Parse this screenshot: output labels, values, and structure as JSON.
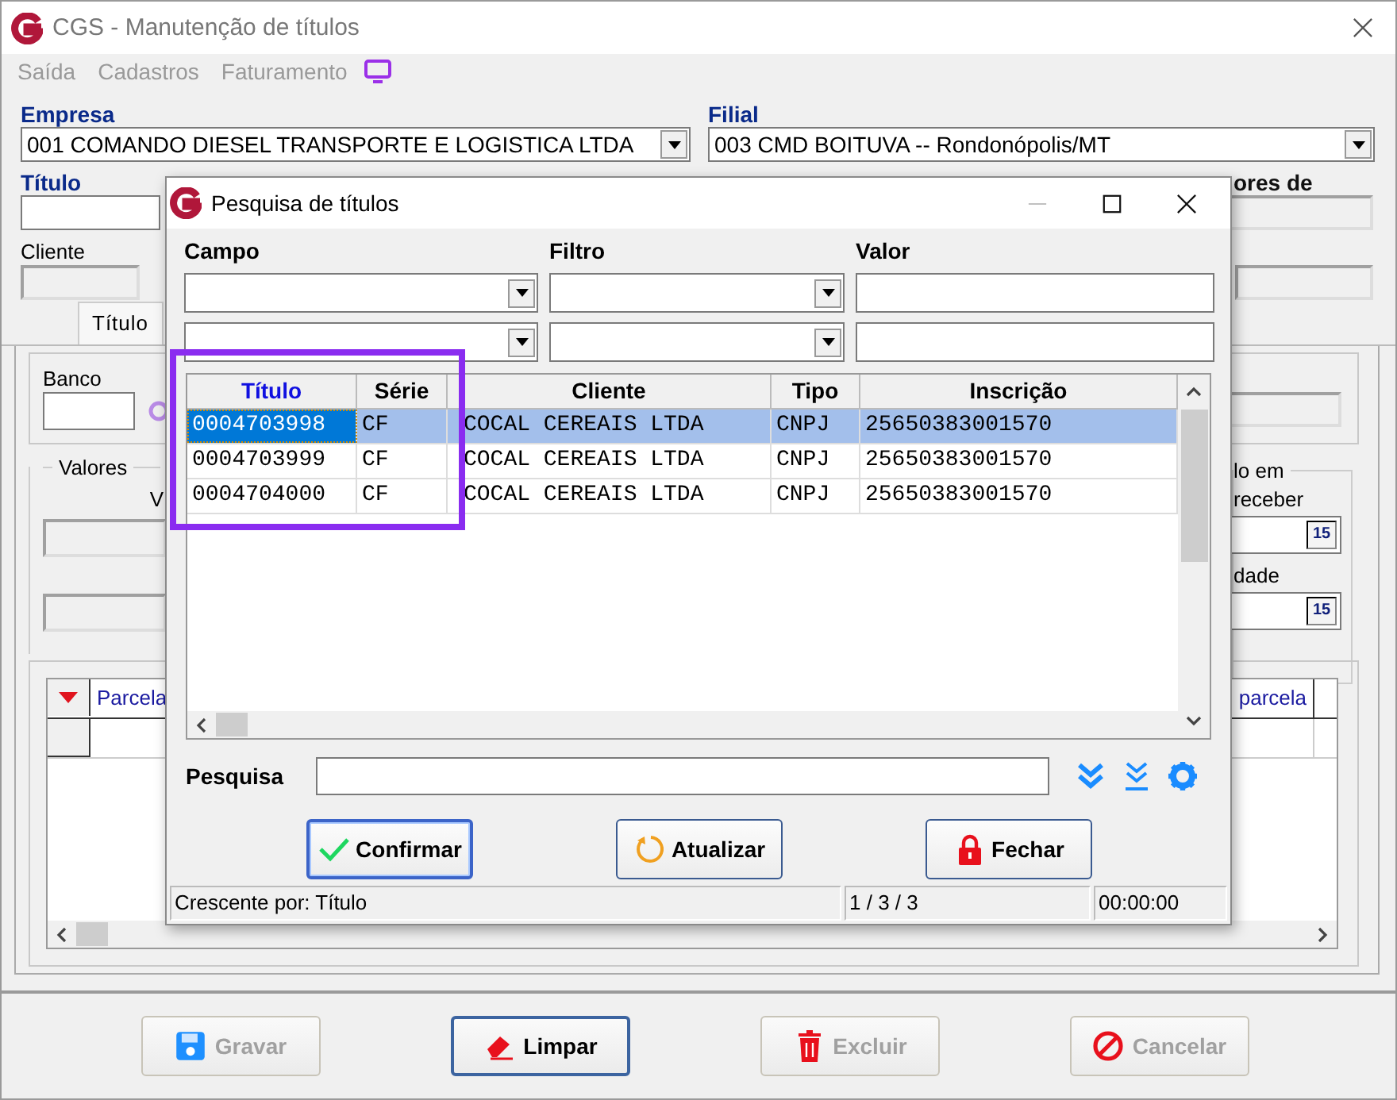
{
  "window": {
    "title": "CGS - Manutenção de títulos"
  },
  "menu": [
    {
      "label": "Saída",
      "disabled": true
    },
    {
      "label": "Cadastros",
      "disabled": true
    },
    {
      "label": "Faturamento",
      "disabled": true
    }
  ],
  "empresa": {
    "label": "Empresa",
    "value": "001 COMANDO DIESEL TRANSPORTE E LOGISTICA LTDA"
  },
  "filial": {
    "label": "Filial",
    "value": "003 CMD BOITUVA -- Rondonópolis/MT"
  },
  "titulo_label": "Título",
  "right_label": "ores de",
  "cliente_label": "Cliente",
  "tabs": [
    {
      "label": "Título",
      "selected": true
    }
  ],
  "banco_label": "Banco",
  "valores": {
    "legend": "Valores",
    "column_label": "V"
  },
  "dates": {
    "legend": "lo em",
    "label_1": "receber",
    "label_2": "dade",
    "calendar_labels": [
      "15",
      "15"
    ]
  },
  "grid": {
    "columns": [
      "Parcela",
      "parcela"
    ]
  },
  "buttons": [
    {
      "label": "Gravar",
      "kind": "save",
      "disabled": true,
      "focused": false
    },
    {
      "label": "Limpar",
      "kind": "eraser",
      "disabled": false,
      "focused": true
    },
    {
      "label": "Excluir",
      "kind": "trash",
      "disabled": true,
      "focused": false
    },
    {
      "label": "Cancelar",
      "kind": "cancel",
      "disabled": true,
      "focused": false
    }
  ],
  "dialog": {
    "title": "Pesquisa de títulos",
    "filter_headers": [
      "Campo",
      "Filtro",
      "Valor"
    ],
    "table": {
      "columns": [
        {
          "label": "Título",
          "sorted": true
        },
        {
          "label": "Série",
          "sorted": false
        },
        {
          "label": "Cliente",
          "sorted": false
        },
        {
          "label": "Tipo",
          "sorted": false
        },
        {
          "label": "Inscrição",
          "sorted": false
        }
      ],
      "rows": [
        {
          "cells": [
            "0004703998",
            "CF",
            "COCAL CEREAIS LTDA",
            "CNPJ",
            "25650383001570"
          ],
          "selected": true
        },
        {
          "cells": [
            "0004703999",
            "CF",
            "COCAL CEREAIS LTDA",
            "CNPJ",
            "25650383001570"
          ],
          "selected": false
        },
        {
          "cells": [
            "0004704000",
            "CF",
            "COCAL CEREAIS LTDA",
            "CNPJ",
            "25650383001570"
          ],
          "selected": false
        }
      ]
    },
    "search_label": "Pesquisa",
    "buttons": [
      {
        "label": "Confirmar",
        "kind": "confirm",
        "focused": true
      },
      {
        "label": "Atualizar",
        "kind": "refresh",
        "focused": false
      },
      {
        "label": "Fechar",
        "kind": "lock",
        "focused": false
      }
    ],
    "status": [
      "Crescente por: Título",
      "1 / 3 / 3",
      "00:00:00"
    ]
  }
}
